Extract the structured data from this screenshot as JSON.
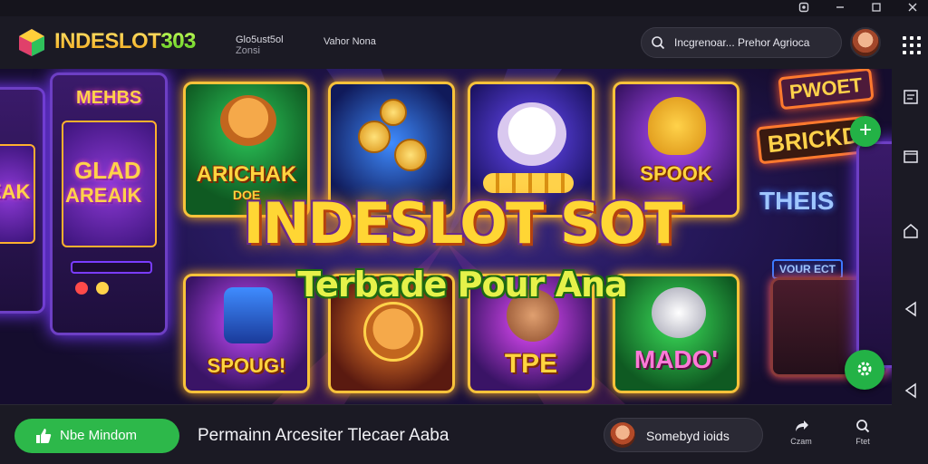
{
  "window": {
    "controls": [
      "settings",
      "minimize",
      "maximize",
      "close"
    ]
  },
  "header": {
    "brand_main": "INDESLOT",
    "brand_num": "303",
    "nav_primary_line1": "Glo5ust5ol",
    "nav_primary_line2": "Zonsi",
    "nav_secondary": "Vahor Nona",
    "search_text": "Incgrenoar... Prehor Agrioca",
    "icons": [
      "search-icon",
      "avatar",
      "apps-grid-icon"
    ]
  },
  "hero": {
    "title": "INDESLOT SOT",
    "subtitle": "Terbade Pour Ana",
    "cards": [
      {
        "label": "ARICHAK",
        "sub": "DOE"
      },
      {
        "label": "",
        "sub": ""
      },
      {
        "label": "",
        "sub": ""
      },
      {
        "label": "SPOOK",
        "sub": ""
      },
      {
        "label": "SPOUG!",
        "sub": ""
      },
      {
        "label": "",
        "sub": ""
      },
      {
        "label": "TPE",
        "sub": ""
      },
      {
        "label": "MADO'",
        "sub": ""
      }
    ],
    "left_cabinet_top": "MEHBS",
    "left_cabinet_screen_1": "GLAD",
    "left_cabinet_screen_2": "AREAIK",
    "left_cabinet_far": "EAK",
    "right_sign_1": "PWOET",
    "right_sign_2": "BRICKD",
    "right_neon": "THEIS",
    "right_small_neon": "VOUR ECT"
  },
  "footer": {
    "cta_label": "Nbe Mindom",
    "title": "Permainn Arcesiter Tlecaer Aaba",
    "user_name": "Somebyd ioids",
    "btn1_label": "Czam",
    "btn2_label": "Ftet"
  },
  "colors": {
    "accent_green": "#2db84a",
    "brand_gold": "#ffd634",
    "background": "#1b1a24"
  }
}
